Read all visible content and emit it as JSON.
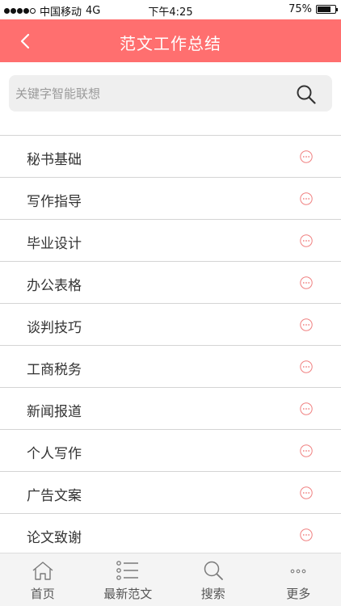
{
  "status_bar": {
    "carrier": "中国移动",
    "network": "4G",
    "time": "下午4:25",
    "battery": "75%",
    "battery_level": 0.75
  },
  "header": {
    "title": "范文工作总结",
    "back_icon": "chevron-left-icon"
  },
  "search": {
    "placeholder": "关键字智能联想",
    "value": "",
    "icon": "search-icon"
  },
  "categories": [
    {
      "label": "秘书基础"
    },
    {
      "label": "写作指导"
    },
    {
      "label": "毕业设计"
    },
    {
      "label": "办公表格"
    },
    {
      "label": "谈判技巧"
    },
    {
      "label": "工商税务"
    },
    {
      "label": "新闻报道"
    },
    {
      "label": "个人写作"
    },
    {
      "label": "广告文案"
    },
    {
      "label": "论文致谢"
    }
  ],
  "tab_bar": {
    "tabs": [
      {
        "label": "首页",
        "icon": "home-icon"
      },
      {
        "label": "最新范文",
        "icon": "list-icon"
      },
      {
        "label": "搜索",
        "icon": "search-icon"
      },
      {
        "label": "更多",
        "icon": "more-icon"
      }
    ]
  },
  "colors": {
    "accent": "#ff6f6f",
    "item_icon": "#f08080"
  }
}
